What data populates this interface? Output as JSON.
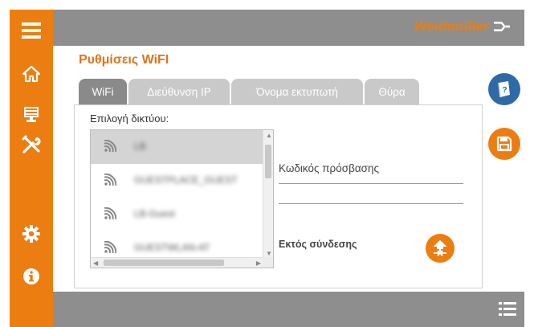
{
  "brand": {
    "name": "Weidmüller",
    "color": "#ec7d10"
  },
  "colors": {
    "accent": "#ec7d10",
    "bar": "#8e8e8e",
    "help": "#2e6aa8",
    "tab_active": "#8a8a8a",
    "tab_inactive": "#c9c9c9"
  },
  "sidebar": {
    "items": [
      {
        "icon": "menu-icon"
      },
      {
        "icon": "home-icon"
      },
      {
        "icon": "printer-screen-icon"
      },
      {
        "icon": "tools-icon"
      },
      {
        "icon": "gear-icon"
      },
      {
        "icon": "info-icon"
      }
    ]
  },
  "page": {
    "title": "Ρυθμίσεις WiFI"
  },
  "tabs": [
    {
      "label": "WiFi",
      "active": true
    },
    {
      "label": "Διεύθυνση IP",
      "active": false
    },
    {
      "label": "Όνομα εκτυπωτή",
      "active": false
    },
    {
      "label": "Θύρα",
      "active": false
    }
  ],
  "network": {
    "label": "Επιλογή δικτύου:",
    "items": [
      {
        "name": "LB",
        "selected": true
      },
      {
        "name": "GUESTPLACE_GUEST",
        "selected": false
      },
      {
        "name": "LB-Guest",
        "selected": false
      },
      {
        "name": "GUESTWLAN-AT",
        "selected": false
      }
    ]
  },
  "password": {
    "label": "Κωδικός πρόσβασης"
  },
  "status": {
    "label": "Εκτός σύνδεσης"
  },
  "bottombar": {
    "icon": "list-icon"
  }
}
